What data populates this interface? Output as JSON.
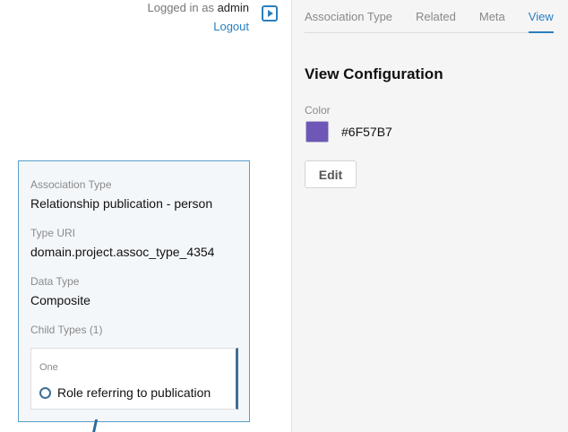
{
  "session": {
    "logged_in_prefix": "Logged in as",
    "username": "admin",
    "logout_label": "Logout",
    "toggle_icon": "panel-toggle-icon"
  },
  "detail": {
    "fields": [
      {
        "label": "Association Type",
        "value": "Relationship publication - person"
      },
      {
        "label": "Type URI",
        "value": "domain.project.assoc_type_4354"
      },
      {
        "label": "Data Type",
        "value": "Composite"
      }
    ],
    "child_types_label": "Child Types (1)",
    "child": {
      "cardinality": "One",
      "name": "Role referring to publication",
      "icon": "ring-icon"
    }
  },
  "panel": {
    "tabs": [
      {
        "label": "Association Type",
        "active": false
      },
      {
        "label": "Related",
        "active": false
      },
      {
        "label": "Meta",
        "active": false
      },
      {
        "label": "View",
        "active": true
      }
    ],
    "title": "View Configuration",
    "color_label": "Color",
    "color_value": "#6F57B7",
    "edit_label": "Edit"
  },
  "colors": {
    "accent": "#2a7fbf",
    "swatch": "#6F57B7"
  }
}
